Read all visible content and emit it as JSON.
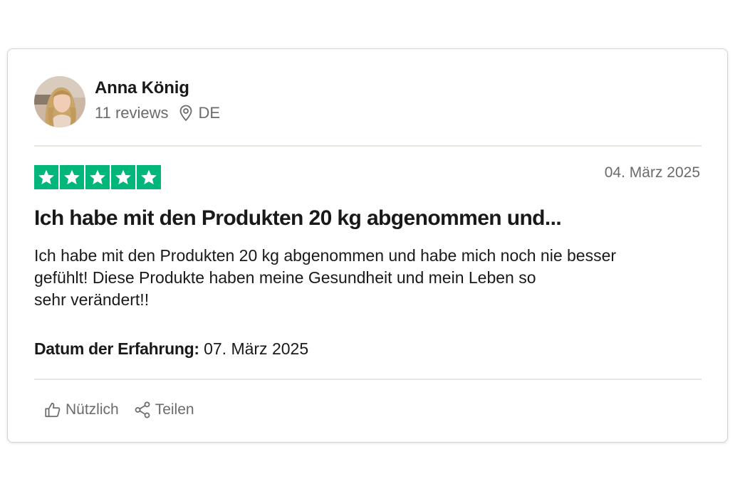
{
  "reviewer": {
    "name": "Anna König",
    "reviews": "11 reviews",
    "country": "DE"
  },
  "rating": {
    "stars": 5,
    "max": 5,
    "color": "#00b67a"
  },
  "review": {
    "date": "04. März 2025",
    "title": "Ich habe mit den Produkten 20 kg abgenommen und...",
    "body_lines": [
      "Ich habe mit den Produkten 20 kg abgenommen und habe mich noch nie besser",
      "gefühlt! Diese Produkte haben meine Gesundheit und mein Leben so",
      "sehr verändert!!"
    ],
    "experience_label": "Datum der Erfahrung:",
    "experience_date": "07. März 2025"
  },
  "actions": {
    "useful_label": "Nützlich",
    "share_label": "Teilen"
  },
  "icons": {
    "location": "map-pin-icon",
    "useful": "thumbs-up-icon",
    "share": "share-icon",
    "star": "star-icon"
  }
}
